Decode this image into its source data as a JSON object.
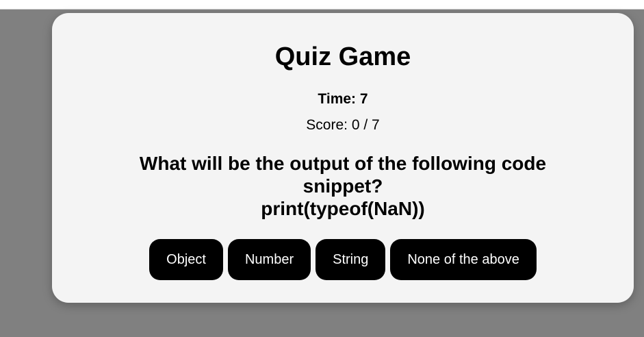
{
  "quiz": {
    "title": "Quiz Game",
    "timer_text": "Time: 7",
    "score_text": "Score: 0 / 7",
    "question_line1": "What will be the output of the following code snippet?",
    "question_line2": "print(typeof(NaN))",
    "options": [
      {
        "label": "Object"
      },
      {
        "label": "Number"
      },
      {
        "label": "String"
      },
      {
        "label": "None of the above"
      }
    ]
  },
  "colors": {
    "page_background": "#808080",
    "card_background": "#f4f4f4",
    "button_background": "#000000",
    "button_text": "#ffffff"
  }
}
